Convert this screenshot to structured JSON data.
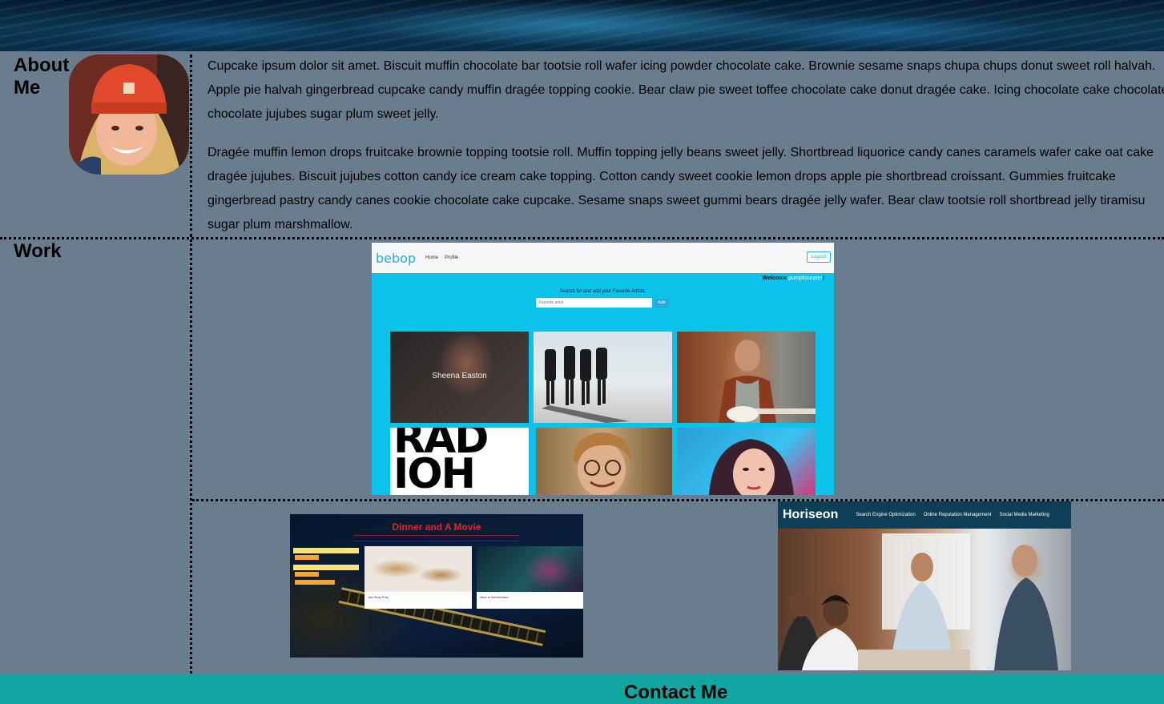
{
  "about": {
    "heading": "About Me",
    "paragraphs": [
      "Cupcake ipsum dolor sit amet. Biscuit muffin chocolate bar tootsie roll wafer icing powder chocolate cake. Brownie sesame snaps chupa chups donut sweet roll halvah.",
      "Apple pie halvah gingerbread cupcake candy muffin dragée topping cookie. Bear claw pie sweet toffee chocolate cake donut dragée cake. Icing chocolate cake chocolate",
      "chocolate jujubes sugar plum sweet jelly.",
      "Dragée muffin lemon drops fruitcake brownie topping tootsie roll. Muffin topping jelly beans sweet jelly. Shortbread liquorice candy canes caramels wafer cake oat cake",
      "dragée jujubes. Biscuit jujubes cotton candy ice cream cake topping. Cotton candy sweet cookie lemon drops apple pie shortbread croissant. Gummies fruitcake",
      "gingerbread pastry candy canes cookie chocolate cake cupcake. Sesame snaps sweet gummi bears dragée jelly wafer. Bear claw tootsie roll shortbread jelly tiramisu",
      "sugar plum marshmallow."
    ]
  },
  "work": {
    "heading": "Work",
    "bebop": {
      "brand": "bebop",
      "nav": [
        "Home",
        "Profile"
      ],
      "logout": "Logout",
      "welcome": "Welcome",
      "username": "pumpkineater",
      "welcome_end": "!",
      "search_label": "Search for and add your Favorite Artists:",
      "search_placeholder": "Favorite artist",
      "add_label": "Add",
      "featured_artist": "Sheena Easton",
      "tile_text": "RAD IOH"
    },
    "dinner": {
      "title": "Dinner and A Movie",
      "cards": [
        "Jeni Roly-Poly",
        "Alice in Wonderland"
      ]
    },
    "horiseon": {
      "brand": "Horiseon",
      "nav": [
        "Search Engine Optimization",
        "Online Reputation Management",
        "Social Media Marketing"
      ]
    }
  },
  "contact": {
    "heading": "Contact Me"
  },
  "colors": {
    "page_bg": "#6a7d8e",
    "footer_bg": "#13a5a1",
    "bebop_bg": "#0bc3ea",
    "dinner_title": "#e0262b"
  }
}
